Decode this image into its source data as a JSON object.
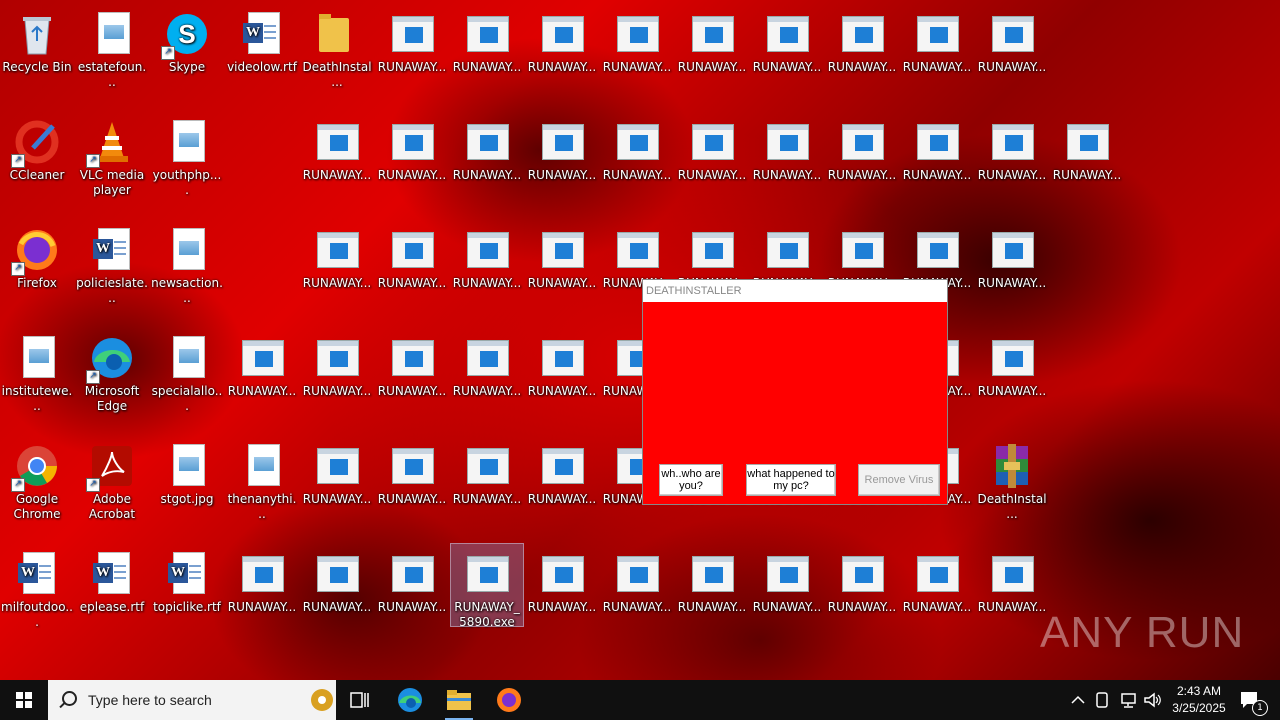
{
  "desktop": {
    "icons": {
      "recycle_bin": "Recycle Bin",
      "estatefoun": "estatefoun...",
      "skype": "Skype",
      "videolow": "videolow.rtf",
      "deathinstal_folder": "DeathInstal...",
      "ccleaner": "CCleaner",
      "vlc": "VLC media player",
      "youthphp": "youthphp....",
      "firefox": "Firefox",
      "policieslate": "policieslate...",
      "newsaction": "newsaction...",
      "institutewe": "institutewe...",
      "edge": "Microsoft Edge",
      "specialallo": "specialallo...",
      "chrome": "Google Chrome",
      "acrobat": "Adobe Acrobat",
      "stgot": "stgot.jpg",
      "thenanythi": "thenanythi...",
      "deathinstal_rar": "DeathInstal...",
      "milfoutdoo": "milfoutdoo...",
      "eplease": "eplease.rtf",
      "topiclike": "topiclike.rtf",
      "runaway_selected": "RUNAWAY_5890.exe",
      "runaway": "RUNAWAY..."
    }
  },
  "dialog": {
    "title": "DEATHINSTALLER",
    "btn_who": "wh..who are you?",
    "btn_what": "what happened to my pc?",
    "btn_remove": "Remove Virus"
  },
  "watermark": "ANY RUN",
  "taskbar": {
    "search_placeholder": "Type here to search",
    "time": "2:43 AM",
    "date": "3/25/2025",
    "notification_count": "1"
  },
  "colors": {
    "dialog_bg": "#ff0000",
    "taskbar_bg": "#101010"
  }
}
